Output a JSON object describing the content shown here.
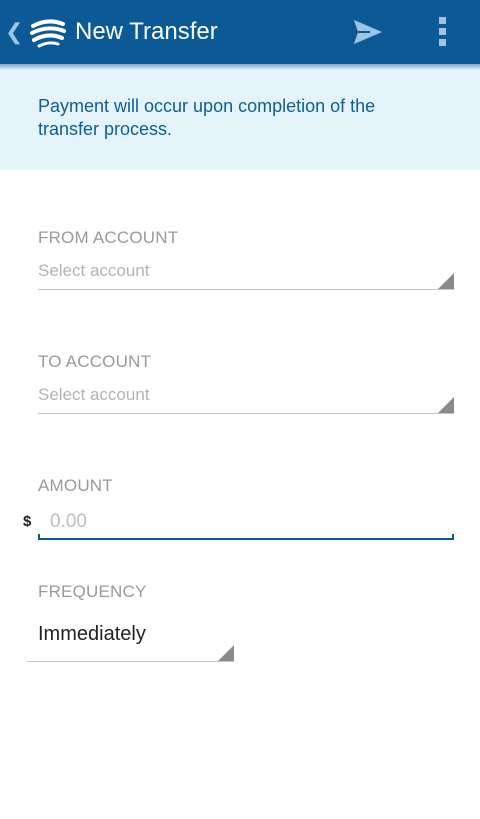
{
  "appbar": {
    "back_icon": "chevron-left-icon",
    "logo_icon": "bank-logo-icon",
    "title": "New Transfer",
    "send_icon": "send-icon",
    "overflow_icon": "overflow-menu-icon"
  },
  "banner": {
    "text": "Payment will occur upon completion of the transfer process."
  },
  "form": {
    "from_account": {
      "label": "FROM ACCOUNT",
      "placeholder": "Select account"
    },
    "to_account": {
      "label": "TO ACCOUNT",
      "placeholder": "Select account"
    },
    "amount": {
      "label": "AMOUNT",
      "currency": "$",
      "placeholder": "0.00"
    },
    "frequency": {
      "label": "FREQUENCY",
      "value": "Immediately"
    }
  },
  "colors": {
    "appbar": "#0b5a96",
    "banner_bg": "#e5f3fb",
    "banner_text": "#0d5e99",
    "icon_light": "#9fc3e2"
  }
}
